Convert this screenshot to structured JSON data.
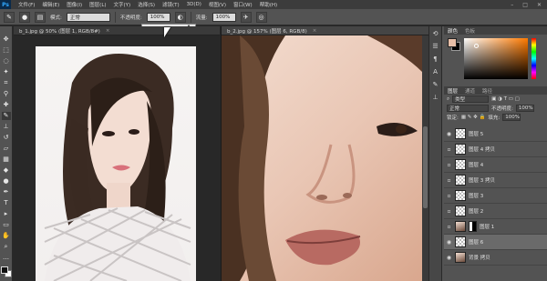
{
  "app": {
    "logo": "Ps"
  },
  "menu": [
    "文件(F)",
    "编辑(E)",
    "图像(I)",
    "图层(L)",
    "文字(Y)",
    "选择(S)",
    "滤镜(T)",
    "3D(D)",
    "视图(V)",
    "窗口(W)",
    "帮助(H)"
  ],
  "window_controls": {
    "minimize": "–",
    "maximize": "□",
    "close": "✕"
  },
  "options": {
    "mode_label": "模式:",
    "mode_value": "正常",
    "opacity_label": "不透明度:",
    "opacity_value": "100%",
    "flow_label": "流量:",
    "flow_value": "100%"
  },
  "documents": [
    {
      "tab": "b_1.jpg @ 50% (图层 1, RGB/8#)",
      "close": "×"
    },
    {
      "tab": "b_2.jpg @ 157% (图层 6, RGB/8)",
      "close": "×"
    }
  ],
  "color_panel": {
    "tabs": [
      "颜色",
      "色板"
    ],
    "foreground": "#e8bfa8",
    "background": "#000000"
  },
  "layers_panel": {
    "tabs": [
      "图层",
      "通道",
      "路径"
    ],
    "filter_kind": "类型",
    "blend_mode": "正常",
    "opacity_label": "不透明度:",
    "opacity_value": "100%",
    "lock_label": "锁定:",
    "fill_label": "填充:",
    "fill_value": "100%",
    "layers": [
      {
        "name": "图层 5",
        "visible": true
      },
      {
        "name": "图层 4 拷贝",
        "visible": false
      },
      {
        "name": "图层 4",
        "visible": false
      },
      {
        "name": "图层 3 拷贝",
        "visible": false
      },
      {
        "name": "图层 3",
        "visible": false
      },
      {
        "name": "图层 2",
        "visible": false
      },
      {
        "name": "图层 1",
        "visible": false
      },
      {
        "name": "图层 6",
        "visible": true
      },
      {
        "name": "背景 拷贝",
        "visible": true
      }
    ]
  }
}
